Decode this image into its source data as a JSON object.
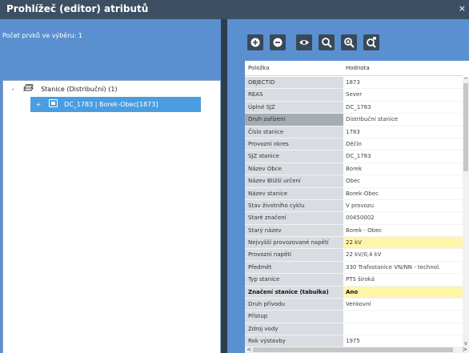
{
  "window": {
    "title": "Prohlížeč (editor) atributů",
    "close_glyph": "×"
  },
  "left_panel": {
    "selection_count": "Počet prvků ve výběru: 1",
    "tree": {
      "root": {
        "expander": "-",
        "icon": "layer-stack-icon",
        "label": "Stanice (Distribuční) (1)"
      },
      "child": {
        "expander": "+",
        "icon": "feature-icon",
        "label": "DC_1783 | Borek-Obec[1873]"
      }
    }
  },
  "toolbar": {
    "buttons": [
      {
        "icon": "zoom-in-circle-icon"
      },
      {
        "icon": "minus-circle-icon"
      },
      {
        "icon": "eye-icon"
      },
      {
        "icon": "search-icon"
      },
      {
        "icon": "zoom-plus-icon"
      },
      {
        "icon": "zoom-lock-icon"
      }
    ]
  },
  "grid": {
    "columns": [
      "Položka",
      "Hodnota"
    ],
    "rows": [
      {
        "key": "OBJECTID",
        "value": "1873"
      },
      {
        "key": "REAS",
        "value": "Sever"
      },
      {
        "key": "Úplné SJZ",
        "value": "DC_1783"
      },
      {
        "key": "Druh zařízení",
        "value": "Distribuční stanice",
        "selected": true
      },
      {
        "key": "Číslo stanice",
        "value": "1783"
      },
      {
        "key": "Provozní okres",
        "value": "Děčín"
      },
      {
        "key": "SJZ stanice",
        "value": "DC_1783"
      },
      {
        "key": "Název Obce",
        "value": "Borek"
      },
      {
        "key": "Název Bližší určení",
        "value": "Obec"
      },
      {
        "key": "Název stanice",
        "value": "Borek-Obec"
      },
      {
        "key": "Stav životního cyklu",
        "value": "V provozu"
      },
      {
        "key": "Staré značení",
        "value": "00450002"
      },
      {
        "key": "Starý název",
        "value": "Borek - Obec"
      },
      {
        "key": "Nejvyšší provozované napětí",
        "value": "22 kV",
        "highlight": true
      },
      {
        "key": "Provozní napětí",
        "value": "22 kV/0,4 kV"
      },
      {
        "key": "Předmět",
        "value": "330 Trafostanice VN/NN - technol."
      },
      {
        "key": "Typ stanice",
        "value": "PTS široká"
      },
      {
        "key": "Značení stanice (tabulka)",
        "value": "Ano",
        "highlight": true,
        "bold": true
      },
      {
        "key": "Druh přívodu",
        "value": "Venkovní"
      },
      {
        "key": "Přístup",
        "value": ""
      },
      {
        "key": "Zdroj vody",
        "value": ""
      },
      {
        "key": "Rok výstavby",
        "value": "1975"
      }
    ],
    "scroll": {
      "up": "^",
      "down": "v",
      "left": "<",
      "right": ">"
    }
  },
  "colors": {
    "titlebar": "#3d4f63",
    "panel": "#5b90d0",
    "selected_tree_item": "#4a9de0",
    "highlight": "#fff5a8",
    "key_cell": "#d9dde2"
  }
}
